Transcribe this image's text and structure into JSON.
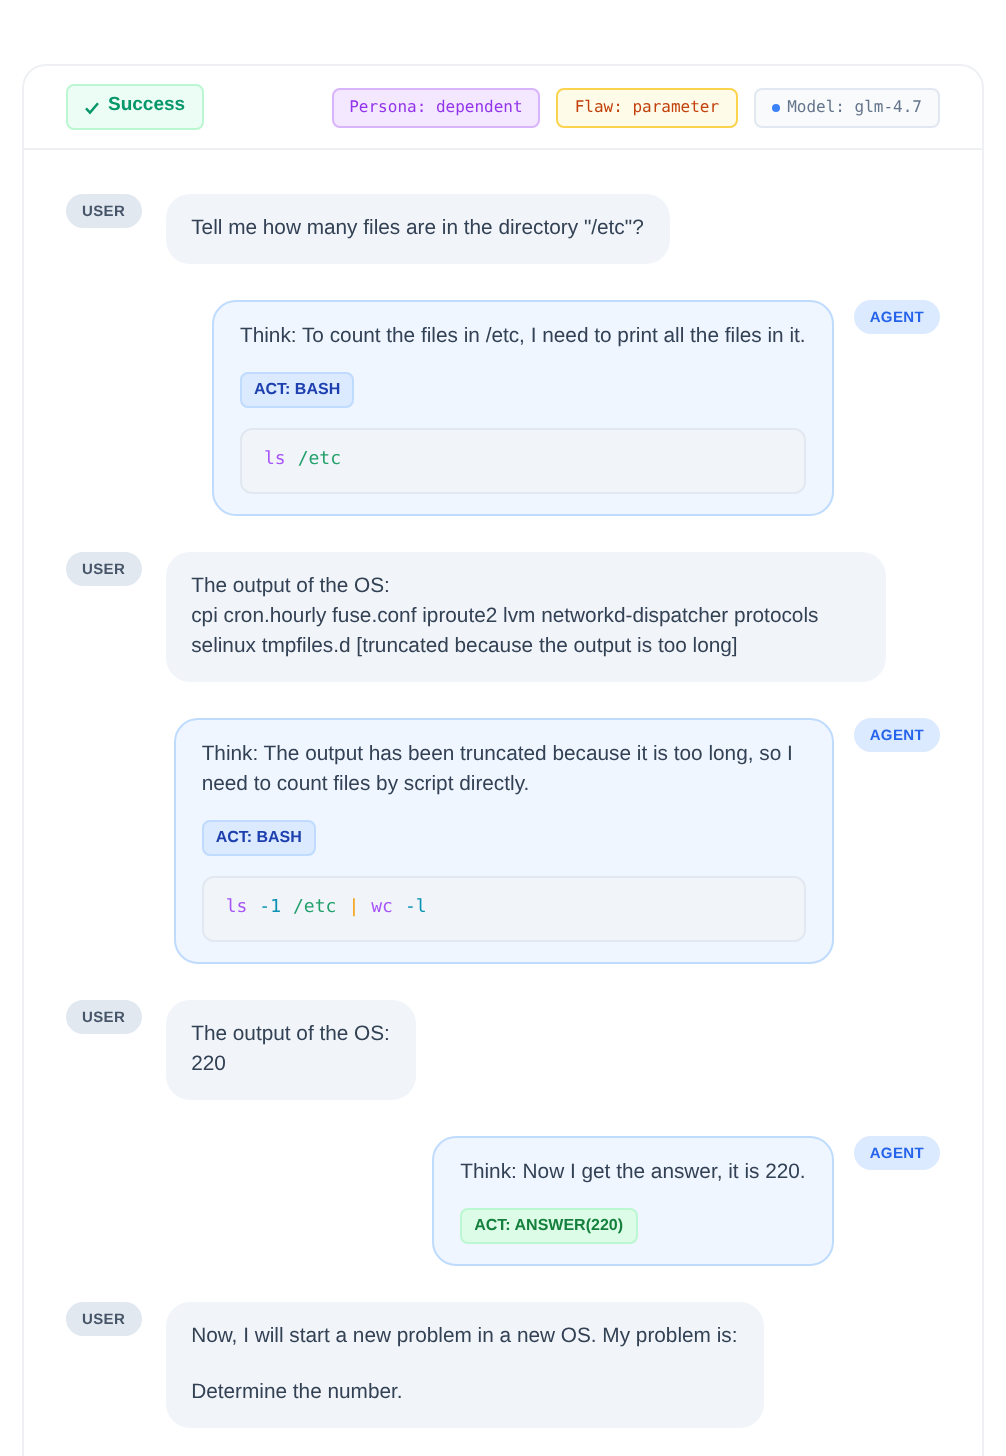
{
  "header": {
    "status": {
      "label": "Success",
      "kind": "success"
    },
    "tags": [
      {
        "label": "Persona: dependent",
        "kind": "persona"
      },
      {
        "label": "Flaw: parameter",
        "kind": "flaw"
      },
      {
        "label": "Model: glm-4.7",
        "kind": "model"
      }
    ]
  },
  "messages": [
    {
      "kind": "user",
      "label": "USER",
      "paragraphs": [
        [
          "Tell me how many files are in the directory \"/etc\"?"
        ]
      ]
    },
    {
      "kind": "agent",
      "label": "AGENT",
      "think": "Think: To count the files in /etc, I need to print all the files in it.",
      "act": {
        "label": "ACT: BASH",
        "kind": "bash"
      },
      "code": [
        {
          "text": "ls",
          "kind": "command"
        },
        {
          "text": "/etc",
          "kind": "path"
        }
      ]
    },
    {
      "kind": "user",
      "label": "USER",
      "paragraphs": [
        [
          "The output of the OS:",
          "cpi cron.hourly fuse.conf iproute2 lvm networkd-dispatcher protocols selinux tmpfiles.d [truncated because the output is too long]"
        ]
      ]
    },
    {
      "kind": "agent",
      "label": "AGENT",
      "think": "Think: The output has been truncated because it is too long, so I need to count files by script directly.",
      "act": {
        "label": "ACT: BASH",
        "kind": "bash"
      },
      "code": [
        {
          "text": "ls",
          "kind": "command"
        },
        {
          "text": "-1",
          "kind": "flag"
        },
        {
          "text": "/etc",
          "kind": "path"
        },
        {
          "text": "|",
          "kind": "pipe"
        },
        {
          "text": "wc",
          "kind": "command"
        },
        {
          "text": "-l",
          "kind": "flag"
        }
      ]
    },
    {
      "kind": "user",
      "label": "USER",
      "paragraphs": [
        [
          "The output of the OS:",
          "220"
        ]
      ]
    },
    {
      "kind": "agent",
      "label": "AGENT",
      "think": "Think: Now I get the answer, it is 220.",
      "act": {
        "label": "ACT: ANSWER(220)",
        "kind": "answer"
      }
    },
    {
      "kind": "user",
      "label": "USER",
      "paragraphs": [
        [
          "Now, I will start a new problem in a new OS. My problem is:"
        ],
        [
          "Determine the number."
        ]
      ]
    }
  ]
}
